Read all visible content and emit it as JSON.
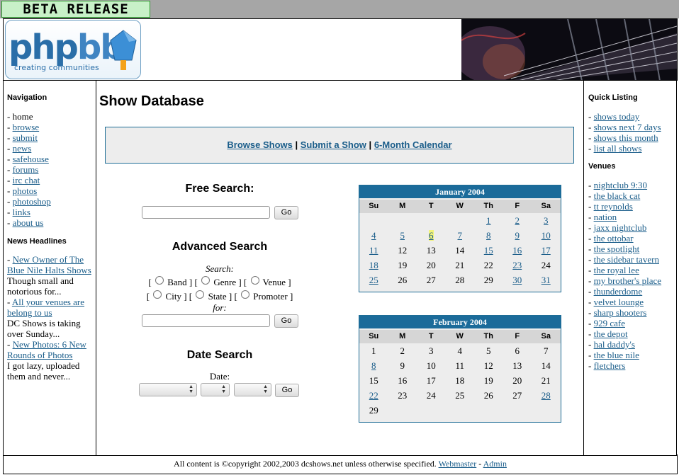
{
  "beta_label": "BETA RELEASE",
  "logo": {
    "word1": "php",
    "word2": "bb",
    "tagline": "creating communities"
  },
  "left": {
    "nav_heading": "Navigation",
    "nav": [
      {
        "label": "home",
        "link": false
      },
      {
        "label": "browse",
        "link": true
      },
      {
        "label": "submit",
        "link": true
      },
      {
        "label": "news",
        "link": true
      },
      {
        "label": "safehouse",
        "link": true
      },
      {
        "label": "forums",
        "link": true
      },
      {
        "label": "irc chat",
        "link": true
      },
      {
        "label": "photos",
        "link": true
      },
      {
        "label": "photoshop",
        "link": true
      },
      {
        "label": "links",
        "link": true
      },
      {
        "label": "about us",
        "link": true
      }
    ],
    "news_heading": "News Headlines",
    "news": [
      {
        "title": "New Owner of The Blue Nile Halts Shows",
        "text": "Though small and notorious for..."
      },
      {
        "title": "All your venues are belong to us",
        "text": "DC Shows is taking over Sunday..."
      },
      {
        "title": "New Photos: 6 New Rounds of Photos",
        "text": "I got lazy, uploaded them and never..."
      }
    ]
  },
  "main": {
    "title": "Show Database",
    "links": [
      "Browse Shows",
      "Submit a Show",
      "6-Month Calendar"
    ],
    "link_sep": "|",
    "free_search": {
      "heading": "Free Search:",
      "button": "Go",
      "value": ""
    },
    "advanced": {
      "heading": "Advanced Search",
      "label_search": "Search:",
      "row1": [
        "Band",
        "Genre",
        "Venue"
      ],
      "row2": [
        "City",
        "State",
        "Promoter"
      ],
      "label_for": "for:",
      "button": "Go",
      "value": ""
    },
    "date_search": {
      "heading": "Date Search",
      "label": "Date:",
      "button": "Go"
    },
    "calendars": [
      {
        "title": "January 2004",
        "dows": [
          "Su",
          "M",
          "T",
          "W",
          "Th",
          "F",
          "Sa"
        ],
        "offset": 4,
        "days": 31,
        "linked": [
          1,
          2,
          3,
          4,
          5,
          6,
          7,
          8,
          9,
          10,
          11,
          15,
          16,
          17,
          18,
          23,
          25,
          30,
          31
        ],
        "today": 6
      },
      {
        "title": "February 2004",
        "dows": [
          "Su",
          "M",
          "T",
          "W",
          "Th",
          "F",
          "Sa"
        ],
        "offset": 0,
        "days": 29,
        "linked": [
          8,
          22,
          28
        ],
        "today": null
      }
    ]
  },
  "right": {
    "quick_heading": "Quick Listing",
    "quick": [
      "shows today",
      "shows next 7 days",
      "shows this month",
      "list all shows"
    ],
    "venues_heading": "Venues",
    "venues": [
      "nightclub 9:30",
      "the black cat",
      "tt reynolds",
      "nation",
      "jaxx nightclub",
      "the ottobar",
      "the spotlight",
      "the sidebar tavern",
      "the royal lee",
      "my brother's place",
      "thunderdome",
      "velvet lounge",
      "sharp shooters",
      "929 cafe",
      "the depot",
      "hal daddy's",
      "the blue nile",
      "fletchers"
    ]
  },
  "footer": {
    "text": "All content is ©copyright 2002,2003 dcshows.net unless otherwise specified.",
    "webmaster": "Webmaster",
    "sep": "-",
    "admin": "Admin"
  },
  "colors": {
    "link": "#1a5d8a",
    "calendar_header": "#1b6b9a",
    "panel_bg": "#ededed",
    "today_highlight": "#f3f37a"
  }
}
